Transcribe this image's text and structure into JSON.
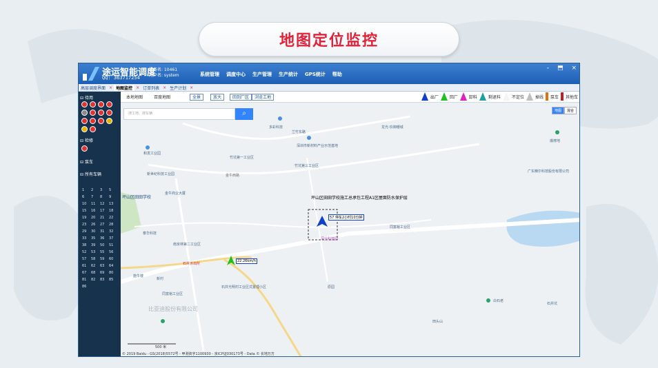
{
  "page": {
    "title": "地图定位监控"
  },
  "app": {
    "brand": "途运智能调度",
    "qq": "QQ: 363717254",
    "server_line": "服务名: 10461",
    "user_line": "用户名: system",
    "nav": [
      "系统管理",
      "调度中心",
      "生产管理",
      "生产统计",
      "GPS统计",
      "帮助"
    ],
    "window_buttons": [
      "-",
      "⬒",
      "×"
    ]
  },
  "tabs": [
    {
      "label": "高层调度界面",
      "active": false
    },
    {
      "label": "地图监控",
      "active": true
    },
    {
      "label": "订单列表",
      "active": false
    },
    {
      "label": "生产计划",
      "active": false
    }
  ],
  "sidebar": {
    "sections": [
      "待用",
      "检修",
      "泵车",
      "所有车辆"
    ],
    "vehicle_numbers": [
      "1",
      "2",
      "3",
      "5",
      "6",
      "7",
      "8",
      "9",
      "10",
      "11",
      "12",
      "13",
      "15",
      "16",
      "17",
      "18",
      "19",
      "20",
      "21",
      "22",
      "23",
      "26",
      "27",
      "28",
      "29",
      "30",
      "31",
      "32",
      "33",
      "35",
      "36",
      "37",
      "38",
      "39",
      "50",
      "51",
      "52",
      "53",
      "55",
      "56",
      "57",
      "58",
      "59",
      "60",
      "61",
      "62",
      "63",
      "64",
      "67",
      "68",
      "69",
      "80",
      "81",
      "82",
      "83",
      "85",
      "86"
    ]
  },
  "map": {
    "tabs": [
      "本地地图",
      "百度地图"
    ],
    "buttons": [
      "全景",
      "放大",
      "回到厂区",
      "浏览工地"
    ],
    "search_placeholder": "搜工地、搜车辆",
    "legend": [
      {
        "label": "出厂",
        "color": "#1040c8"
      },
      {
        "label": "回厂",
        "color": "#20c020"
      },
      {
        "label": "卸料",
        "color": "#e020c0"
      },
      {
        "label": "剩退料",
        "color": "#20a0a0"
      },
      {
        "label": "不定位",
        "color": "#ffffff"
      },
      {
        "label": "掉线",
        "color": "#c0c0c0"
      },
      {
        "label": "泵车",
        "color": "#e07010"
      },
      {
        "label": "其他车",
        "color": "#c02020"
      }
    ],
    "maptype": [
      "地图",
      "混合"
    ],
    "site_label": "坪山区田田学校施工总承包工程A1区屋面防水保护层",
    "vehicle1_label": "57 停车2小时10分钟",
    "vehicle2_label": "22.26km/h",
    "places": [
      "兰竹东路",
      "深圳市新材料产业示范基地",
      "竹坑第一工业区",
      "竹坑第三工业区",
      "多彩科技",
      "龙光·玖御珊城",
      "爆燎地",
      "广东精尔科技股份有限公司",
      "和发工业园",
      "新世纪科技工业园",
      "金牛西路",
      "金牛商业大厦",
      "坪山区田田学校",
      "石井派出所",
      "深业科技园",
      "泰华科技",
      "石井光明村工业区式置理小区",
      "同富裕工业区",
      "南京林第二工业区",
      "比亚迪股份有限公司",
      "新村",
      "施牛楼",
      "田头山",
      "白石老",
      "石井坑",
      "原园",
      "同富裕工业区"
    ],
    "copyright": "© 2019 Baidu - GS(2018)5572号 - 甲测资字1100930 - 京ICP证030173号 - Data © 长地万方",
    "scale": "500 米"
  }
}
